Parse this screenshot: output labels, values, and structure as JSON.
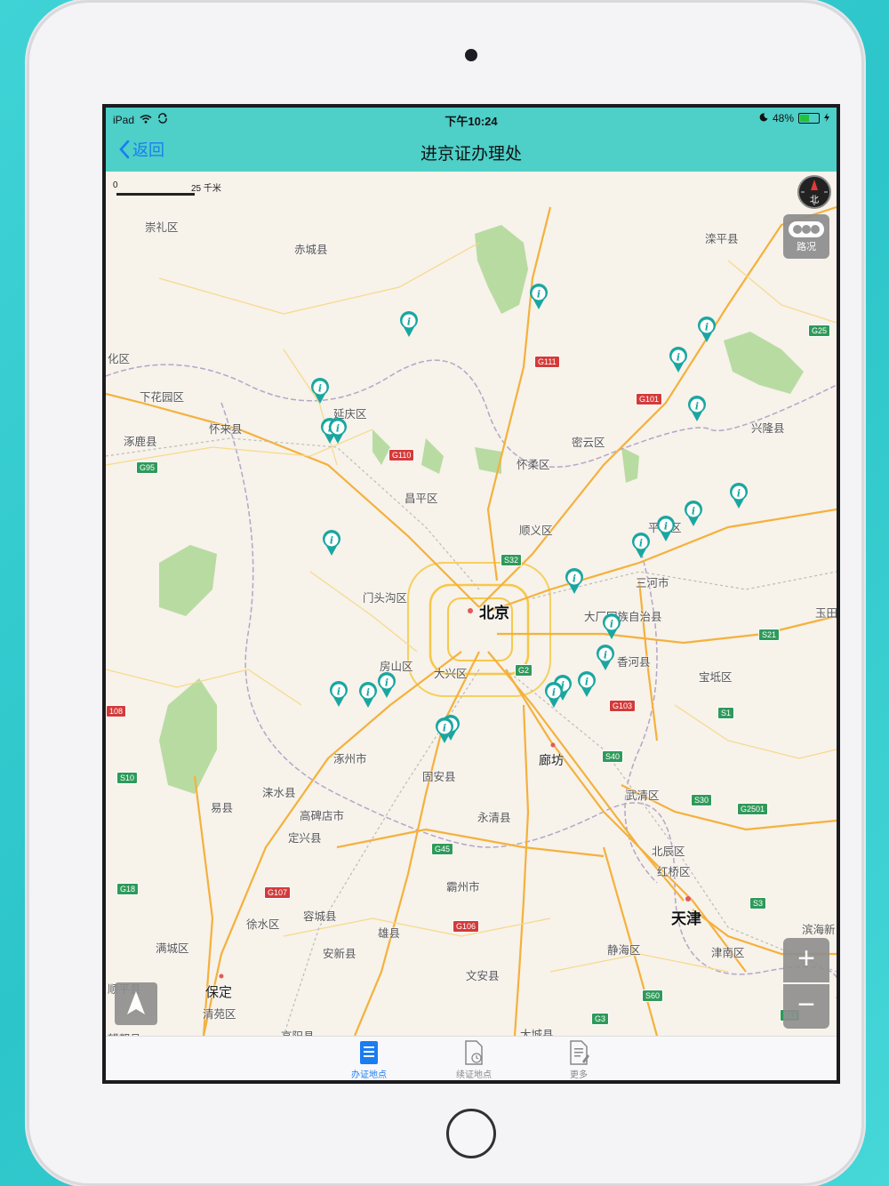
{
  "statusbar": {
    "device": "iPad",
    "time": "下午10:24",
    "battery": "48%",
    "battery_level": 0.48
  },
  "navbar": {
    "back_label": "返回",
    "title": "进京证办理处"
  },
  "map": {
    "scale_zero": "0",
    "scale_label": "25 千米",
    "compass_label": "北",
    "traffic_label": "路况",
    "zoom_in": "+",
    "zoom_out": "−",
    "cities": {
      "beijing": "北京",
      "tianjin": "天津",
      "langfang": "廊坊",
      "baoding": "保定"
    },
    "places": [
      "崇礼区",
      "赤城县",
      "滦平县",
      "化区",
      "下花园区",
      "延庆区",
      "怀来县",
      "涿鹿县",
      "密云区",
      "兴隆县",
      "怀柔区",
      "昌平区",
      "顺义区",
      "平谷区",
      "门头沟区",
      "三河市",
      "玉田",
      "大厂回族自治县",
      "房山区",
      "大兴区",
      "香河县",
      "宝坻区",
      "涿州市",
      "固安县",
      "涞水县",
      "易县",
      "高碑店市",
      "定兴县",
      "永清县",
      "武清区",
      "北辰区",
      "红桥区",
      "霸州市",
      "徐水区",
      "容城县",
      "雄县",
      "满城区",
      "安新县",
      "文安县",
      "静海区",
      "津南区",
      "滨海新",
      "清苑区",
      "顺平县",
      "望都县",
      "高阳县",
      "大城县"
    ],
    "shields": [
      "G111",
      "G101",
      "G25",
      "G110",
      "G95",
      "S32",
      "S21",
      "G2",
      "G103",
      "S1",
      "S40",
      "S30",
      "G2501",
      "S10",
      "G45",
      "G18",
      "G107",
      "S3",
      "G106",
      "S60",
      "G3",
      "S11",
      "108"
    ]
  },
  "tabbar": {
    "tabs": [
      {
        "label": "办证地点",
        "active": true
      },
      {
        "label": "续证地点",
        "active": false
      },
      {
        "label": "更多",
        "active": false
      }
    ]
  },
  "colors": {
    "accent": "#4ecfc8",
    "active_tab": "#1a7df0",
    "pin": "#1aa6a0"
  }
}
